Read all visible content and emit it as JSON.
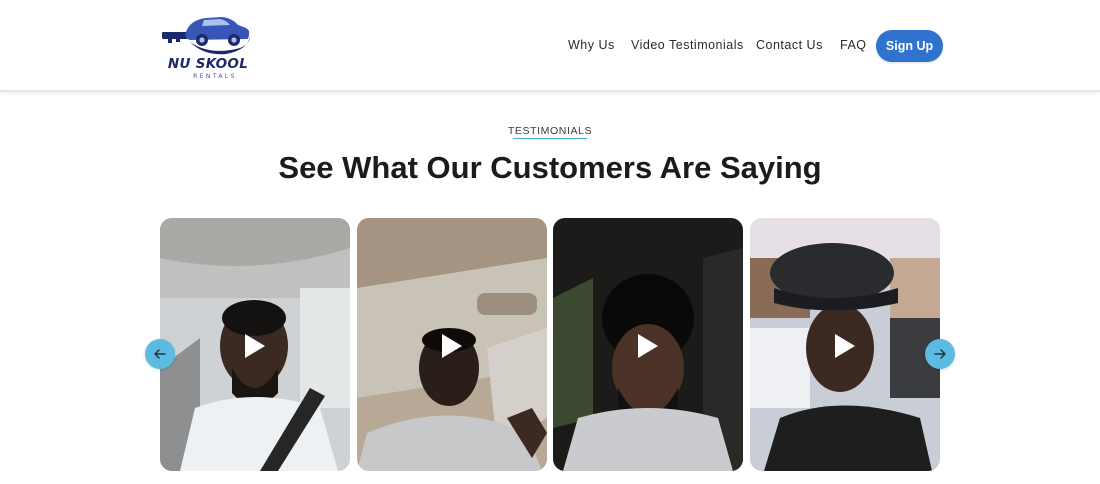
{
  "brand": {
    "name": "NU SKOOL",
    "tagline": "RENTALS",
    "primary_color": "#2f73cf",
    "accent_color": "#5cbbe0",
    "logo_color": "#1c2a6b"
  },
  "nav": {
    "items": [
      {
        "label": "Why Us"
      },
      {
        "label": "Video Testimonials"
      },
      {
        "label": "Contact Us"
      },
      {
        "label": "FAQ"
      }
    ],
    "cta_label": "Sign Up"
  },
  "section": {
    "eyebrow": "TESTIMONIALS",
    "title": "See What Our Customers Are Saying"
  },
  "carousel": {
    "prev_icon": "arrow-left-icon",
    "next_icon": "arrow-right-icon",
    "videos": [
      {
        "icon": "play-icon",
        "thumbnail": "man in white t-shirt wearing seatbelt in car"
      },
      {
        "icon": "play-icon",
        "thumbnail": "man in gray tank top in car"
      },
      {
        "icon": "play-icon",
        "thumbnail": "man in gray hoodie in dark car"
      },
      {
        "icon": "play-icon",
        "thumbnail": "man in flat cap outdoors"
      }
    ]
  }
}
